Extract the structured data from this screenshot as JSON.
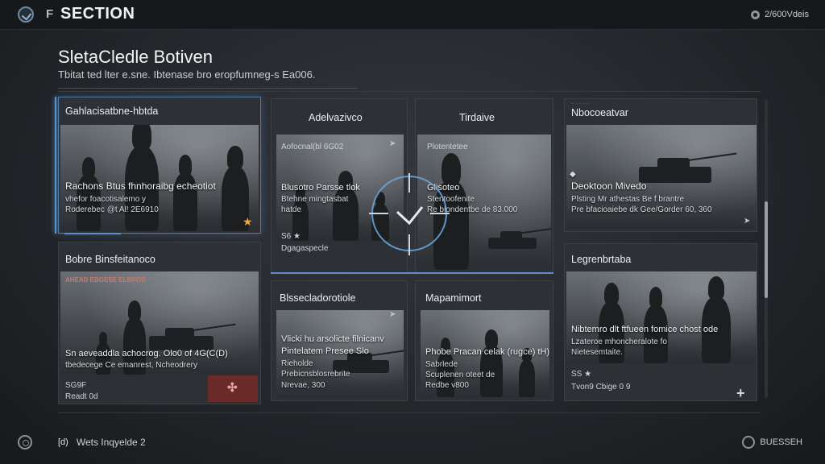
{
  "topbar": {
    "section_label": "SECTION",
    "menu_glyph": "F",
    "right_label": "2/600Vdeis"
  },
  "header": {
    "title": "SletaCledle Botiven",
    "subtitle": "Tbitat ted lter e.sne. Ibtenase bro eropfumneg-s Ea006."
  },
  "cards": {
    "c1": {
      "title": "Gahlacisatbne-hbtda",
      "line1": "Rachons Btus fhnhoraibg echeotiot",
      "line2": "vhefor foacotisalemo y",
      "line3": "Roderebec @t Al! 2E6910"
    },
    "c2": {
      "title": "Bobre Binsfeitanoco",
      "strap": "AHEAD EBGESE ELBROD",
      "line1": "Sn aeveaddla achocrog. Olo0 of 4G(C(D)",
      "line2": "tbedecege Ce emanrest, Ncheodrery",
      "meta1": "SG9F",
      "meta2": "Readt 0d"
    },
    "c3": {
      "title": "Adelvazivco",
      "small_label": "Aofocnal(bl 6G02",
      "line1": "Blusotro Parsse tlok",
      "line2": "Btehne mingtasbat",
      "line3": "hatde",
      "meta1": "S6 ★",
      "meta2": "Dgagaspecle"
    },
    "c4": {
      "title": "Tirdaive",
      "small_label": "Plotentetee",
      "line1": "Glisoteo",
      "line2": "Stentoofenite",
      "line3": "Re blondentbe de 83.000"
    },
    "c5": {
      "title": "Blssecladorotiole",
      "line1": "Vlicki hu arsolicte filnicanv",
      "line2": "Pintelatem Presee Slo",
      "line3": "Rieholde",
      "line4": "Prebicnsblosrebrite",
      "line5": "Nrevae, 300"
    },
    "c6": {
      "title": "Mapamimort",
      "line1": "Phobe Pracan celak (rugce) tH)",
      "line2": "Sabrlede",
      "line3": "Scuplenen oteet de",
      "line4": "Redbe v800"
    },
    "c7": {
      "title": "Nbocoeatvar",
      "line1": "Deoktoon Mivedo",
      "line2": "Plsting Mr athestas Be f brantre",
      "line3": "Pre bfacioaiebe dk Gee/Gorder 60, 360"
    },
    "c8": {
      "title": "Legrenbrtaba",
      "line1": "Nibtemro dlt ftfueen fomice chost ode",
      "line2": "Lzateroe mhoncheralote fo",
      "line3": "Nietesemtaite.",
      "meta1": "SS ★",
      "meta2": "Tvon9 Cbige 0 9"
    }
  },
  "footer": {
    "key_label": "[d)",
    "action_label": "Wets Inqyelde 2",
    "right_label": "BUESSEH"
  }
}
